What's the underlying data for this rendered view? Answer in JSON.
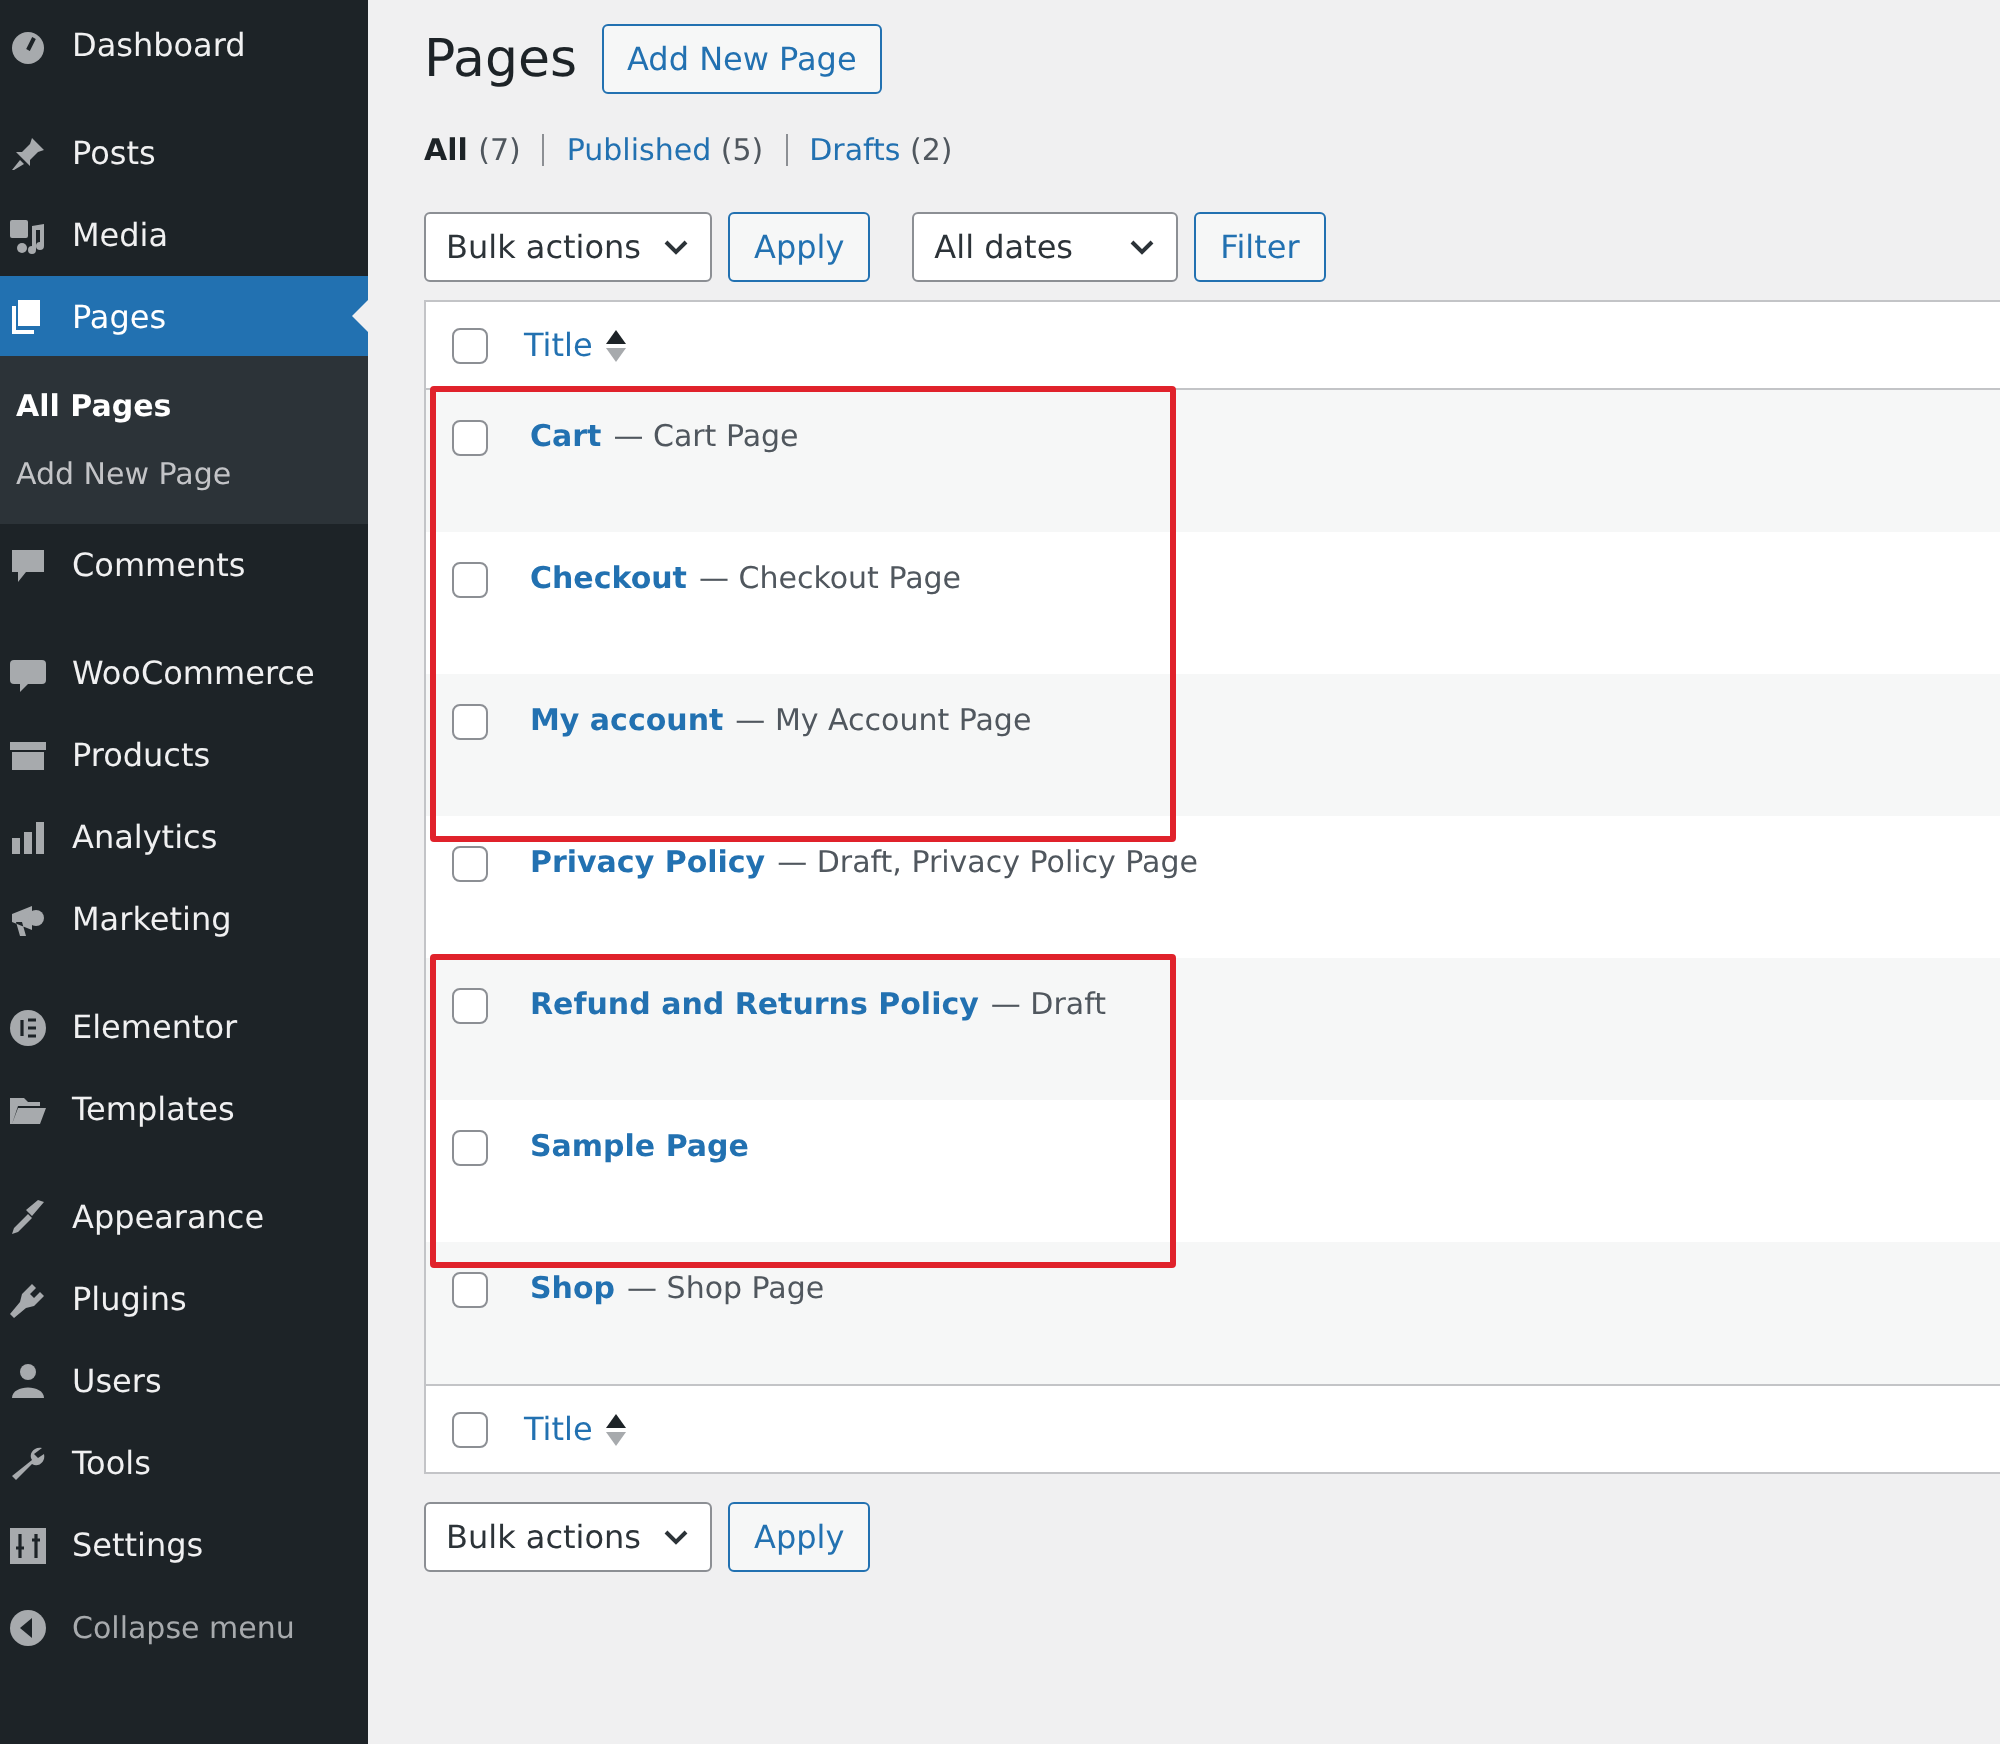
{
  "sidebar": {
    "groups": [
      [
        {
          "label": "Dashboard",
          "selected": false
        }
      ],
      [
        {
          "label": "Posts",
          "selected": false
        },
        {
          "label": "Media",
          "selected": false
        },
        {
          "label": "Pages",
          "selected": true,
          "submenu": [
            {
              "label": "All Pages",
              "selected": true
            },
            {
              "label": "Add New Page",
              "selected": false
            }
          ]
        },
        {
          "label": "Comments",
          "selected": false
        }
      ],
      [
        {
          "label": "WooCommerce",
          "selected": false
        },
        {
          "label": "Products",
          "selected": false
        },
        {
          "label": "Analytics",
          "selected": false
        },
        {
          "label": "Marketing",
          "selected": false
        }
      ],
      [
        {
          "label": "Elementor",
          "selected": false
        },
        {
          "label": "Templates",
          "selected": false
        }
      ],
      [
        {
          "label": "Appearance",
          "selected": false
        },
        {
          "label": "Plugins",
          "selected": false
        },
        {
          "label": "Users",
          "selected": false
        },
        {
          "label": "Tools",
          "selected": false
        },
        {
          "label": "Settings",
          "selected": false
        }
      ]
    ],
    "collapse": "Collapse menu"
  },
  "page": {
    "title": "Pages",
    "add_button": "Add New Page",
    "views": [
      {
        "label": "All",
        "count": "(7)",
        "selected": true
      },
      {
        "label": "Published",
        "count": "(5)",
        "selected": false
      },
      {
        "label": "Drafts",
        "count": "(2)",
        "selected": false
      }
    ],
    "top_toolbar": {
      "bulk_select": "Bulk actions",
      "apply": "Apply",
      "dates_select": "All dates",
      "filter": "Filter"
    },
    "table": {
      "header": "Title",
      "header_checked": false,
      "footer": "Title",
      "footer_checked": false,
      "rows": [
        {
          "title": "Cart",
          "state": "— Cart Page",
          "checked": false,
          "highlighted": true
        },
        {
          "title": "Checkout",
          "state": "— Checkout Page",
          "checked": false,
          "highlighted": true
        },
        {
          "title": "My account",
          "state": "— My Account Page",
          "checked": false,
          "highlighted": true
        },
        {
          "title": "Privacy Policy",
          "state": "— Draft, Privacy Policy Page",
          "checked": false,
          "highlighted": false
        },
        {
          "title": "Refund and Returns Policy",
          "state": "— Draft",
          "checked": false,
          "highlighted": true
        },
        {
          "title": "Sample Page",
          "state": "",
          "checked": false,
          "highlighted": true
        },
        {
          "title": "Shop",
          "state": "— Shop Page",
          "checked": false,
          "highlighted": false
        }
      ]
    },
    "bottom_toolbar": {
      "bulk_select": "Bulk actions",
      "apply": "Apply"
    }
  }
}
